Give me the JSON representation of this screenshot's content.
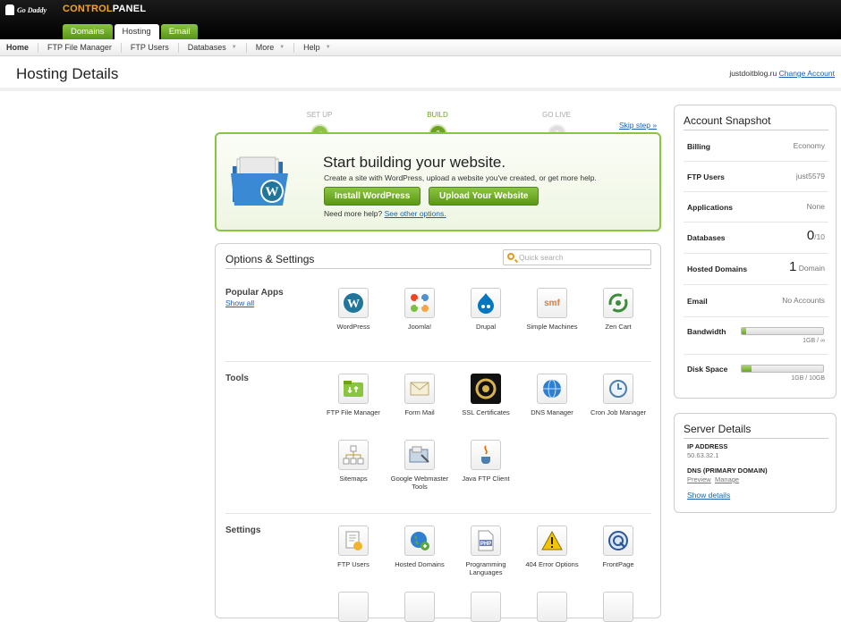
{
  "brand": {
    "logo_text": "Go Daddy",
    "title_a": "CONTROL",
    "title_b": "PANEL"
  },
  "tabs": [
    {
      "label": "Domains"
    },
    {
      "label": "Hosting"
    },
    {
      "label": "Email"
    }
  ],
  "nav": [
    {
      "label": "Home"
    },
    {
      "label": "FTP File Manager"
    },
    {
      "label": "FTP Users"
    },
    {
      "label": "Databases"
    },
    {
      "label": "More"
    },
    {
      "label": "Help"
    }
  ],
  "page": {
    "title": "Hosting Details",
    "account": "justdoitblog.ru",
    "change_account": "Change Account"
  },
  "progress": {
    "steps": [
      {
        "label": "SET UP",
        "mark": "✓"
      },
      {
        "label": "BUILD",
        "mark": "2"
      },
      {
        "label": "GO LIVE",
        "mark": "3"
      }
    ],
    "skip": "Skip step »"
  },
  "build": {
    "title": "Start building your website.",
    "desc": "Create a site with WordPress, upload a website you've created, or get more help.",
    "install_btn": "Install WordPress",
    "upload_btn": "Upload Your Website",
    "help_text": "Need more help?",
    "help_link": "See other options."
  },
  "options": {
    "title": "Options & Settings",
    "search_placeholder": "Quick search",
    "sections": [
      {
        "title": "Popular Apps",
        "link": "Show all",
        "apps": [
          "WordPress",
          "Joomla!",
          "Drupal",
          "Simple Machines",
          "Zen Cart"
        ]
      },
      {
        "title": "Tools",
        "apps": [
          "FTP File Manager",
          "Form Mail",
          "SSL Certificates",
          "DNS Manager",
          "Cron Job Manager",
          "Sitemaps",
          "Google Webmaster Tools",
          "Java FTP Client"
        ]
      },
      {
        "title": "Settings",
        "apps": [
          "FTP Users",
          "Hosted Domains",
          "Programming Languages",
          "404 Error Options",
          "FrontPage"
        ]
      }
    ]
  },
  "snapshot": {
    "title": "Account Snapshot",
    "rows": [
      {
        "label": "Billing",
        "value": "Economy"
      },
      {
        "label": "FTP Users",
        "value": "just5579"
      },
      {
        "label": "Applications",
        "value": "None"
      },
      {
        "label": "Databases",
        "big": "0",
        "value": "/10"
      },
      {
        "label": "Hosted Domains",
        "big": "1",
        "value": "Domain"
      },
      {
        "label": "Email",
        "value": "No Accounts"
      }
    ],
    "bandwidth": {
      "label": "Bandwidth",
      "note": "1GB / ∞",
      "fill_fraction": 0.06
    },
    "disk": {
      "label": "Disk Space",
      "note": "1GB / 10GB",
      "fill_fraction": 0.12
    }
  },
  "server": {
    "title": "Server Details",
    "ip_label": "IP ADDRESS",
    "ip_value": "50.63.32.1",
    "dns_label": "DNS (PRIMARY DOMAIN)",
    "preview": "Preview",
    "manage": "Manage",
    "show_details": "Show details"
  }
}
